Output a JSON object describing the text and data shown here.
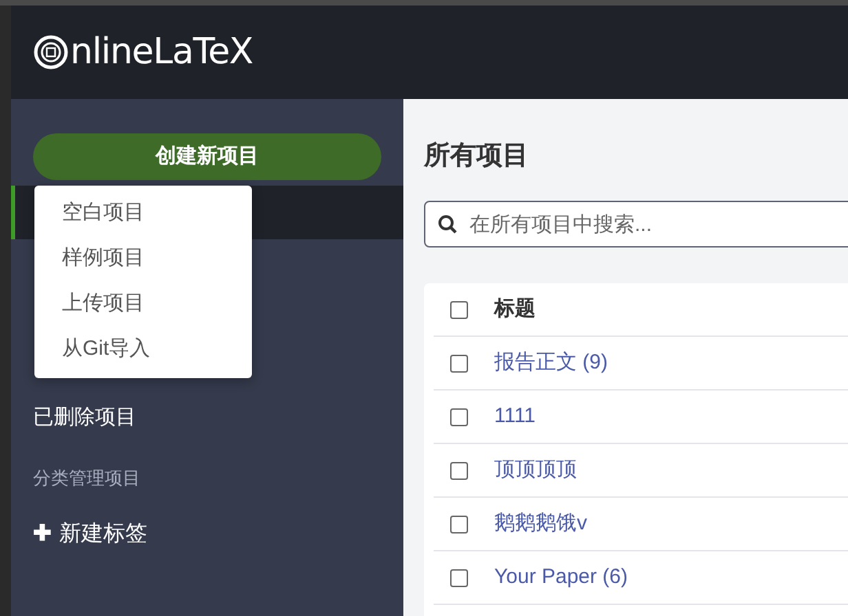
{
  "header": {
    "logo": "nlineLaTeX"
  },
  "sidebar": {
    "new_project_button": "创建新项目",
    "items": [
      {
        "label": "已删除项目",
        "selected": false
      }
    ],
    "section_title": "分类管理项目",
    "new_tag": {
      "icon": "✚",
      "label": "新建标签"
    }
  },
  "new_project_menu": {
    "items": [
      "空白项目",
      "样例项目",
      "上传项目",
      "从Git导入"
    ]
  },
  "main": {
    "title": "所有项目",
    "search": {
      "placeholder": "在所有项目中搜索..."
    },
    "table": {
      "columns": [
        "标题"
      ],
      "header_checked": false,
      "rows": [
        {
          "title": "报告正文 (9)",
          "checked": false
        },
        {
          "title": "1111",
          "checked": false
        },
        {
          "title": "顶顶顶顶",
          "checked": false
        },
        {
          "title": "鹅鹅鹅饿v",
          "checked": false
        },
        {
          "title": "Your Paper (6)",
          "checked": false
        }
      ]
    }
  }
}
